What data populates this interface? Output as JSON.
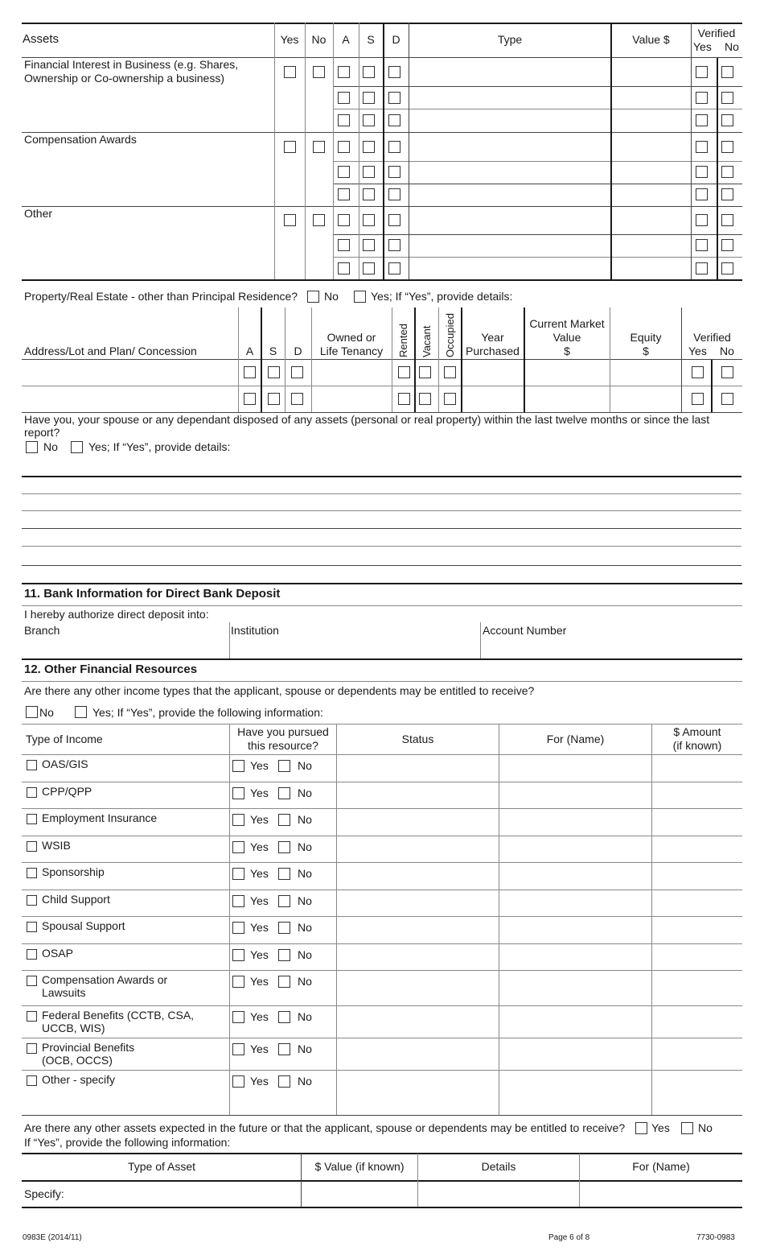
{
  "assets_table": {
    "headers": {
      "assets": "Assets",
      "yes": "Yes",
      "no": "No",
      "a": "A",
      "s": "S",
      "d": "D",
      "type": "Type",
      "value": "Value $",
      "verified": "Verified",
      "verified_yes": "Yes",
      "verified_no": "No"
    },
    "groups": [
      {
        "label_line1": "Financial Interest in Business (e.g. Shares,",
        "label_line2": "Ownership or Co-ownership a business)"
      },
      {
        "label_line1": "Compensation Awards",
        "label_line2": ""
      },
      {
        "label_line1": "Other",
        "label_line2": ""
      }
    ]
  },
  "property": {
    "question": "Property/Real Estate - other than Principal Residence?",
    "no_label": "No",
    "yes_label": "Yes; If “Yes”, provide details:",
    "headers": {
      "address": "Address/Lot and Plan/ Concession",
      "a": "A",
      "s": "S",
      "d": "D",
      "owned_line1": "Owned or",
      "owned_line2": "Life Tenancy",
      "rented": "Rented",
      "vacant": "Vacant",
      "occupied": "Occupied",
      "year_line1": "Year",
      "year_line2": "Purchased",
      "cmv_line1": "Current Market",
      "cmv_line2": "Value",
      "cmv_line3": "$",
      "equity_line1": "Equity",
      "equity_line2": "$",
      "verified": "Verified",
      "verified_yes": "Yes",
      "verified_no": "No"
    }
  },
  "disposed": {
    "question_line1": "Have you, your spouse or any dependant disposed of any assets (personal or real property) within the last twelve months or since the last",
    "question_line2": "report?",
    "no_label": "No",
    "yes_label": "Yes; If “Yes”, provide details:"
  },
  "bank": {
    "title": "11.  Bank Information for Direct Bank Deposit",
    "authorize": "I hereby authorize direct deposit into:",
    "branch": "Branch",
    "institution": "Institution",
    "account_number": "Account Number"
  },
  "other_resources": {
    "title": "12.  Other Financial Resources",
    "question": "Are there any other income types that the applicant, spouse or dependents may be entitled to receive?",
    "no_label": "No",
    "yes_label": "Yes; If “Yes”, provide the following information:",
    "headers": {
      "type": "Type of Income",
      "pursued_line1": "Have you pursued",
      "pursued_line2": "this resource?",
      "status": "Status",
      "for_name": "For (Name)",
      "amount_line1": "$ Amount",
      "amount_line2": "(if known)"
    },
    "yes_label_row": "Yes",
    "no_label_row": "No",
    "rows": [
      {
        "l1": "OAS/GIS",
        "l2": ""
      },
      {
        "l1": "CPP/QPP",
        "l2": ""
      },
      {
        "l1": "Employment Insurance",
        "l2": ""
      },
      {
        "l1": "WSIB",
        "l2": ""
      },
      {
        "l1": "Sponsorship",
        "l2": ""
      },
      {
        "l1": "Child Support",
        "l2": ""
      },
      {
        "l1": "Spousal Support",
        "l2": ""
      },
      {
        "l1": "OSAP",
        "l2": ""
      },
      {
        "l1": "Compensation Awards or",
        "l2": "Lawsuits"
      },
      {
        "l1": "Federal Benefits (CCTB, CSA,",
        "l2": "UCCB, WIS)"
      },
      {
        "l1": "Provincial Benefits",
        "l2": "(OCB, OCCS)"
      },
      {
        "l1": " Other - specify",
        "l2": ""
      }
    ]
  },
  "future_assets": {
    "question": "Are there any other assets expected in the future or that the applicant, spouse or dependents may be entitled to receive?",
    "yes_label": "Yes",
    "no_label": "No",
    "instruction": "If “Yes”, provide the following information:",
    "headers": {
      "type": "Type of Asset",
      "value": "$ Value (if known)",
      "details": "Details",
      "for_name": "For (Name)"
    },
    "specify": "Specify:"
  },
  "footer": {
    "form_id": "0983E (2014/11)",
    "page": "Page 6 of 8",
    "code": "7730-0983"
  }
}
